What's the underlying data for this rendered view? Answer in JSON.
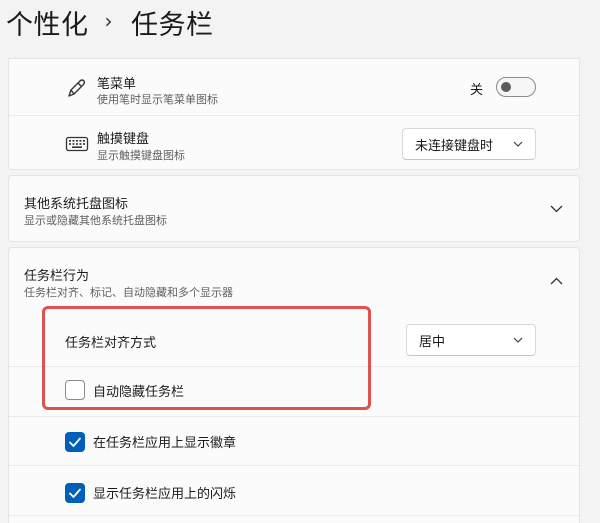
{
  "breadcrumb": {
    "parent": "个性化",
    "separator": "›",
    "current": "任务栏"
  },
  "pen_menu": {
    "title": "笔菜单",
    "subtitle": "使用笔时显示笔菜单图标",
    "toggle_label": "关",
    "toggle_on": false,
    "icon": "pen-icon"
  },
  "touch_keyboard": {
    "title": "触摸键盘",
    "subtitle": "显示触摸键盘图标",
    "dropdown_value": "未连接键盘时",
    "icon": "keyboard-icon"
  },
  "other_tray": {
    "title": "其他系统托盘图标",
    "subtitle": "显示或隐藏其他系统托盘图标",
    "expanded": false
  },
  "taskbar_behavior": {
    "title": "任务栏行为",
    "subtitle": "任务栏对齐、标记、自动隐藏和多个显示器",
    "expanded": true
  },
  "alignment": {
    "label": "任务栏对齐方式",
    "dropdown_value": "居中"
  },
  "checkboxes": [
    {
      "label": "自动隐藏任务栏",
      "checked": false
    },
    {
      "label": "在任务栏应用上显示徽章",
      "checked": true
    },
    {
      "label": "显示任务栏应用上的闪烁",
      "checked": true
    }
  ],
  "colors": {
    "accent": "#005fb8",
    "highlight": "#e0504c"
  }
}
